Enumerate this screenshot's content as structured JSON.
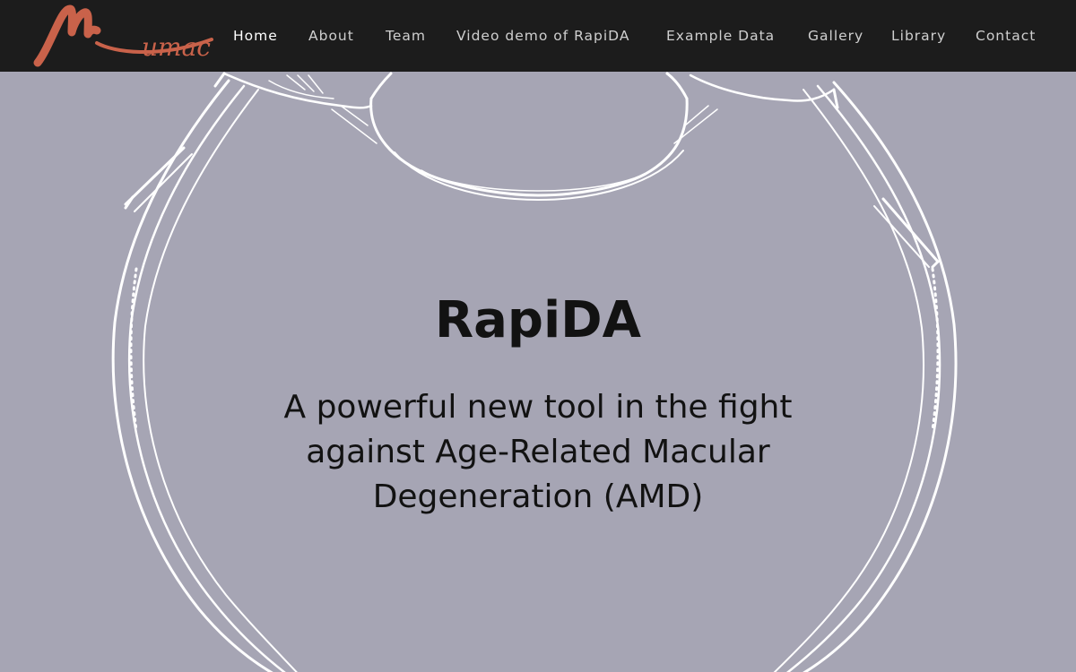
{
  "brand": {
    "logo_text": "Mumac",
    "logo_color": "#c9624a"
  },
  "nav": {
    "home": "Home",
    "about": "About",
    "team": "Team",
    "video_demo": "Video demo of RapiDA",
    "example_data": "Example Data",
    "gallery": "Gallery",
    "library": "Library",
    "contact": "Contact",
    "active": "Home"
  },
  "hero": {
    "title": "RapiDA",
    "subtitle": "A powerful new tool in the fight against Age-Related Macular Degeneration (AMD)",
    "background_color": "#a6a5b4",
    "illustration": "eye-cross-section-line-drawing"
  }
}
